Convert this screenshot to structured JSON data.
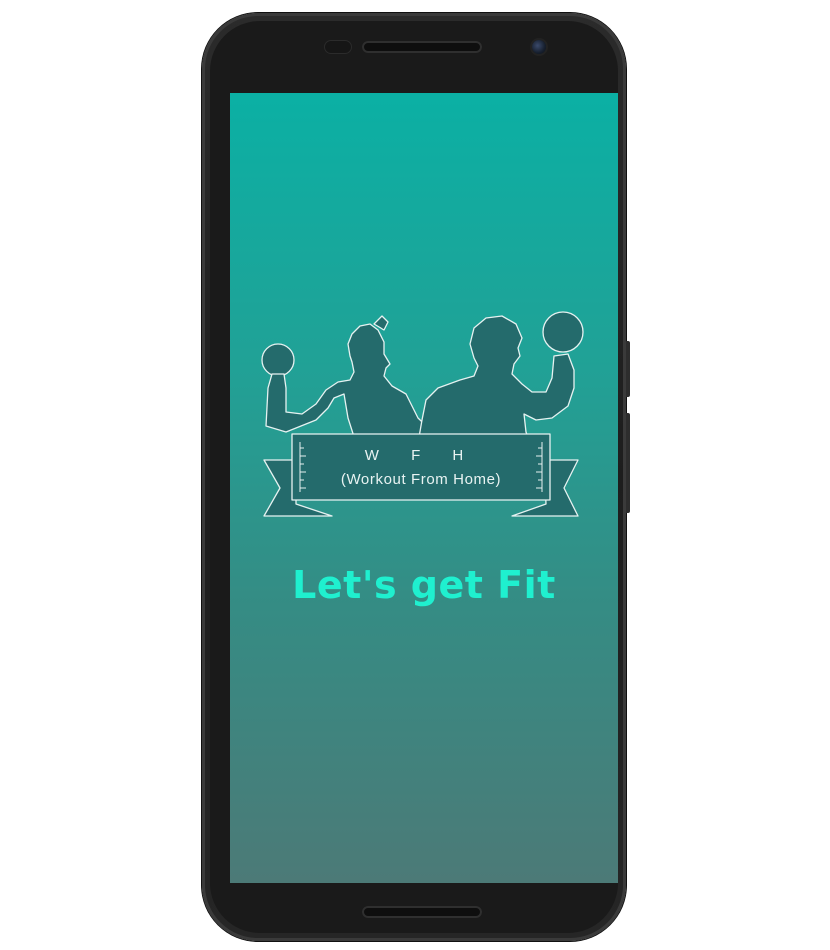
{
  "splash": {
    "logo_title": "W F H",
    "logo_subtitle": "(Workout From Home)",
    "tagline": "Let's get Fit"
  },
  "colors": {
    "gradient_top": "#0bb0a4",
    "gradient_bottom": "#4c7a77",
    "logo_fill": "#246b6c",
    "tagline": "#1ff0cf"
  },
  "icons": {
    "logo": "fitness-couple-dumbbells-icon"
  }
}
